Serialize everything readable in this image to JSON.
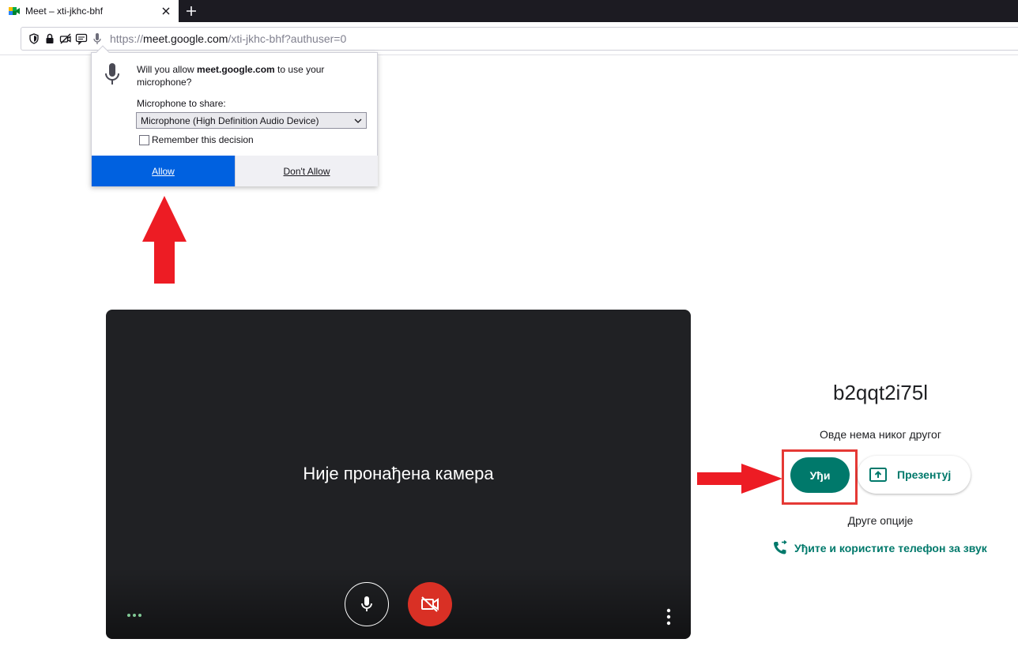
{
  "browser": {
    "tab": {
      "title": "Meet – xti-jkhc-bhf"
    },
    "url": {
      "prefix": "https://",
      "host": "meet.google.com",
      "path": "/xti-jkhc-bhf?authuser=0"
    }
  },
  "permission_popup": {
    "message_pre": "Will you allow ",
    "message_host": "meet.google.com",
    "message_post": " to use your microphone?",
    "device_label": "Microphone to share:",
    "device_selected": "Microphone (High Definition Audio Device)",
    "remember_label": "Remember this decision",
    "remember_checked": false,
    "allow_label": "Allow",
    "deny_label": "Don't Allow"
  },
  "preview": {
    "no_camera_text": "Није пронађена камера"
  },
  "join_panel": {
    "meeting_code": "b2qqt2i75l",
    "participants_text": "Овде нема никог другог",
    "join_label": "Уђи",
    "present_label": "Презентуј",
    "other_options_label": "Друге опције",
    "phone_join_label": "Уђите и користите телефон за звук"
  },
  "colors": {
    "accent_teal": "#00796b",
    "allow_blue": "#0061e0",
    "annotation_red": "#e53935",
    "camera_off_red": "#d93025"
  }
}
